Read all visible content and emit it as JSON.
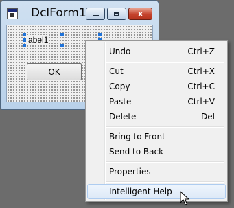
{
  "form": {
    "title": "DclForm1",
    "controls": {
      "minimize": "minimize",
      "maximize": "maximize",
      "close": "x"
    },
    "label1_text": "abel1",
    "ok_button_label": "OK"
  },
  "context_menu": {
    "items": [
      {
        "label": "Undo",
        "shortcut": "Ctrl+Z"
      },
      {
        "label": "Cut",
        "shortcut": "Ctrl+X"
      },
      {
        "label": "Copy",
        "shortcut": "Ctrl+C"
      },
      {
        "label": "Paste",
        "shortcut": "Ctrl+V"
      },
      {
        "label": "Delete",
        "shortcut": "Del"
      },
      {
        "label": "Bring to Front",
        "shortcut": ""
      },
      {
        "label": "Send to Back",
        "shortcut": ""
      },
      {
        "label": "Properties",
        "shortcut": ""
      },
      {
        "label": "Intelligent Help",
        "shortcut": "",
        "highlighted": true
      }
    ]
  },
  "colors": {
    "desktop": "#6c6c6c",
    "menu_highlight_border": "#aeccf0",
    "selection_handle": "#1f72d8",
    "close_button": "#c5432d"
  }
}
